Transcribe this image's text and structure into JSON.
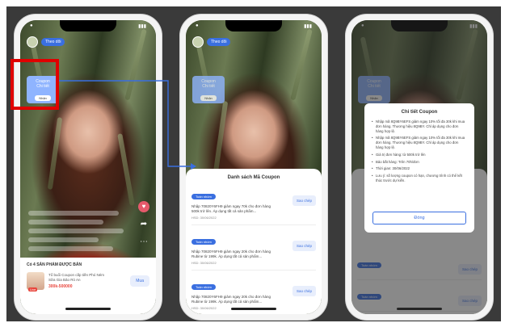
{
  "phone1": {
    "follow_label": "Theo dõi",
    "coupon_button": {
      "line1": "Coupon",
      "line2": "Chi tiết",
      "chip": "Nhận"
    },
    "product_bar": {
      "title": "Có 4 SẢN PHẨM ĐƯỢC BÁN",
      "item_name": "Tổ buổi Coupon cấp tiền Phó Ném Sữa Gia Bảo Rỏ An",
      "price": "300k-500000",
      "tag": "Live",
      "buy_label": "Mua"
    }
  },
  "phone2": {
    "sheet_title": "Danh sách Mã Coupon",
    "coupons": [
      {
        "tag": "Toàn nhóm",
        "desc": "Nhập 70820Y6FH9 giảm ngay 70k cho đơn hàng 500k trở lên. Áp dụng tất cả sản phẩm...",
        "date": "HSD: 30/06/2022",
        "btn": "Sao chép"
      },
      {
        "tag": "Toàn nhóm",
        "desc": "Nhập 70820Y6FH9 giảm ngay 20k cho đơn hàng Rubine từ 199k. Áp dụng tất cả sản phẩm...",
        "date": "HSD: 30/06/2022",
        "btn": "Sao chép"
      },
      {
        "tag": "Toàn nhóm",
        "desc": "Nhập 70820Y6FH9 giảm ngay 20k cho đơn hàng Rubine từ 199k. Áp dụng tất cả sản phẩm...",
        "date": "HSD: 30/06/2022",
        "btn": "Sao chép"
      }
    ]
  },
  "phone3": {
    "modal_title": "Chi tiết Coupon",
    "items": [
      "Nhập mã 8Q9BY6EFS giảm ngay 10% tối đa 30k khi mua đơn hàng. Thương hiệu 8Q9BY. Chỉ áp dụng cho đơn hàng hợp lệ.",
      "Nhập mã 8Q9BY6EFS giảm ngay 10% tối đa 30k khi mua đơn hàng. Thương hiệu 8Q9BY. Chỉ áp dụng cho đơn hàng hợp lệ.",
      "Giá trị đơn hàng: từ 500k trở lên",
      "Bảo bắt hàng: Trên 70h/đơn",
      "Thời gian: 30/06/2022",
      "Lưu ý: số lượng coupon có hạn, chương trình có thể kết thúc trước dự kiến."
    ],
    "close_label": "Đóng",
    "bg_coupon_tag": "Toàn nhóm",
    "bg_btn": "Sao chép"
  },
  "colors": {
    "accent": "#3a6fe0",
    "highlight": "#e00000",
    "backdrop": "#3a3a3a"
  }
}
